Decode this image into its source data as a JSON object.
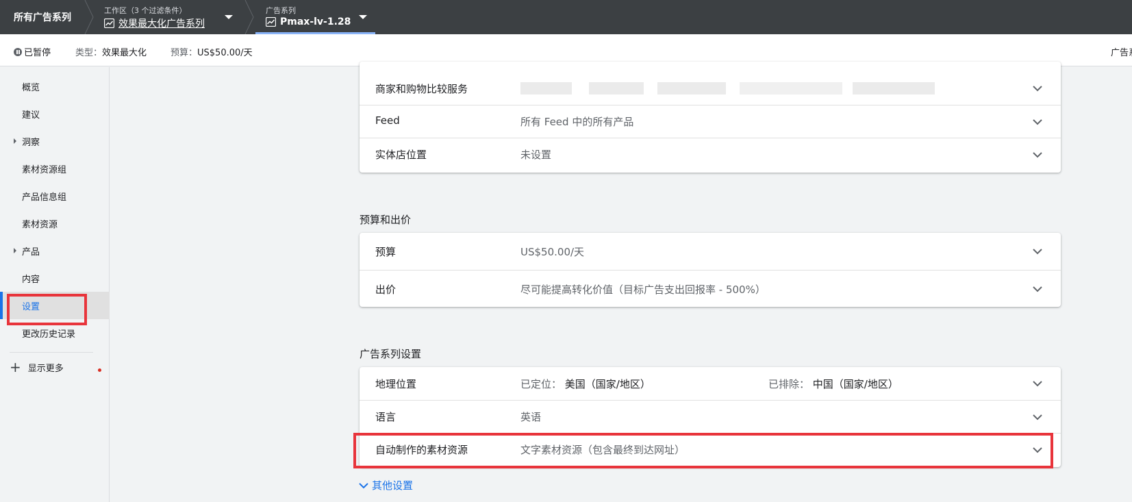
{
  "topbar": {
    "root": "所有广告系列",
    "workspace_label": "工作区（3 个过滤条件）",
    "workspace_value": "效果最大化广告系列",
    "campaign_label": "广告系列",
    "campaign_value": "Pmax-lv-1.28"
  },
  "status": {
    "state": "已暂停",
    "type_label": "类型：",
    "type_value": "效果最大化",
    "budget_label": "预算：",
    "budget_value": "US$50.00/天",
    "right_text": "广告系"
  },
  "sidebar": {
    "items": [
      {
        "label": "概览"
      },
      {
        "label": "建议"
      },
      {
        "label": "洞察"
      },
      {
        "label": "素材资源组"
      },
      {
        "label": "产品信息组"
      },
      {
        "label": "素材资源"
      },
      {
        "label": "产品"
      },
      {
        "label": "内容"
      },
      {
        "label": "设置"
      },
      {
        "label": "更改历史记录"
      }
    ],
    "more": "显示更多"
  },
  "shopping": {
    "merchant_label": "商家和购物比较服务",
    "feed_label": "Feed",
    "feed_value": "所有 Feed 中的所有产品",
    "store_label": "实体店位置",
    "store_value": "未设置"
  },
  "budget_section": {
    "title": "预算和出价",
    "budget_label": "预算",
    "budget_value": "US$50.00/天",
    "bid_label": "出价",
    "bid_value": "尽可能提高转化价值（目标广告支出回报率 - 500%）"
  },
  "campaign_section": {
    "title": "广告系列设置",
    "geo_label": "地理位置",
    "geo_targeted_label": "已定位：",
    "geo_targeted_value": "美国（国家/地区）",
    "geo_excluded_label": "已排除：",
    "geo_excluded_value": "中国（国家/地区）",
    "lang_label": "语言",
    "lang_value": "英语",
    "auto_label": "自动制作的素材资源",
    "auto_value": "文字素材资源（包含最终到达网址）"
  },
  "other_settings": "其他设置",
  "colors": {
    "topbar": "#3c4043",
    "accent": "#1a73e8",
    "highlight": "#e8343b"
  }
}
